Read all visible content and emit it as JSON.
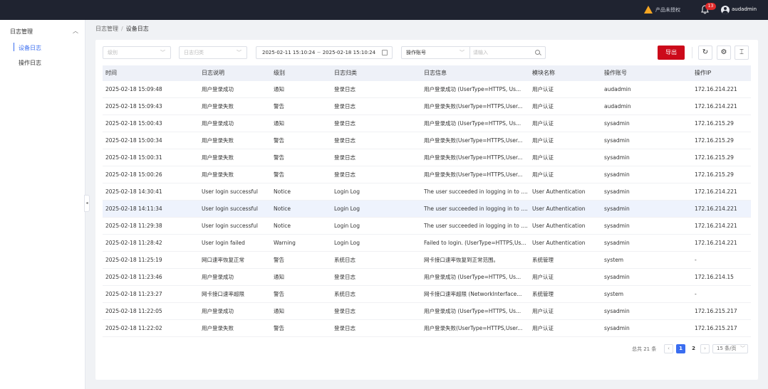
{
  "topbar": {
    "license_warning": "产品未授权",
    "notification_count": "13",
    "username": "audadmin"
  },
  "sidebar": {
    "group_label": "日志管理",
    "items": [
      {
        "label": "设备日志",
        "active": true
      },
      {
        "label": "操作日志",
        "active": false
      }
    ]
  },
  "breadcrumb": {
    "parent": "日志管理",
    "separator": "/",
    "current": "设备日志"
  },
  "filters": {
    "level_placeholder": "级别",
    "category_placeholder": "日志归类",
    "date_start": "2025-02-11 15:10:24",
    "date_separator": "~",
    "date_end": "2025-02-18 15:10:24",
    "field_select": "操作账号",
    "search_placeholder": "请输入"
  },
  "toolbar": {
    "export_label": "导出"
  },
  "table": {
    "columns": [
      "时间",
      "日志说明",
      "级别",
      "日志归类",
      "日志信息",
      "模块名称",
      "操作账号",
      "操作IP"
    ],
    "rows": [
      [
        "2025-02-18 15:09:48",
        "用户登录成功",
        "通知",
        "登录日志",
        "用户登录成功 (UserType=HTTPS, Us...",
        "用户认证",
        "audadmin",
        "172.16.214.221"
      ],
      [
        "2025-02-18 15:09:43",
        "用户登录失败",
        "警告",
        "登录日志",
        "用户登录失败(UserType=HTTPS,User...",
        "用户认证",
        "audadmin",
        "172.16.214.221"
      ],
      [
        "2025-02-18 15:00:43",
        "用户登录成功",
        "通知",
        "登录日志",
        "用户登录成功 (UserType=HTTPS, Us...",
        "用户认证",
        "sysadmin",
        "172.16.215.29"
      ],
      [
        "2025-02-18 15:00:34",
        "用户登录失败",
        "警告",
        "登录日志",
        "用户登录失败(UserType=HTTPS,User...",
        "用户认证",
        "sysadmin",
        "172.16.215.29"
      ],
      [
        "2025-02-18 15:00:31",
        "用户登录失败",
        "警告",
        "登录日志",
        "用户登录失败(UserType=HTTPS,User...",
        "用户认证",
        "sysadmin",
        "172.16.215.29"
      ],
      [
        "2025-02-18 15:00:26",
        "用户登录失败",
        "警告",
        "登录日志",
        "用户登录失败(UserType=HTTPS,User...",
        "用户认证",
        "sysadmin",
        "172.16.215.29"
      ],
      [
        "2025-02-18 14:30:41",
        "User login successful",
        "Notice",
        "Login Log",
        "The user succeeded in logging in to ....",
        "User Authentication",
        "sysadmin",
        "172.16.214.221"
      ],
      [
        "2025-02-18 14:11:34",
        "User login successful",
        "Notice",
        "Login Log",
        "The user succeeded in logging in to ....",
        "User Authentication",
        "sysadmin",
        "172.16.214.221"
      ],
      [
        "2025-02-18 11:29:38",
        "User login successful",
        "Notice",
        "Login Log",
        "The user succeeded in logging in to ....",
        "User Authentication",
        "sysadmin",
        "172.16.214.221"
      ],
      [
        "2025-02-18 11:28:42",
        "User login failed",
        "Warning",
        "Login Log",
        "Failed to login. (UserType=HTTPS,Us...",
        "User Authentication",
        "sysadmin",
        "172.16.214.221"
      ],
      [
        "2025-02-18 11:25:19",
        "网口速率恢复正常",
        "警告",
        "系统日志",
        "网卡接口速率恢复到正常范围。",
        "系统管理",
        "system",
        "-"
      ],
      [
        "2025-02-18 11:23:46",
        "用户登录成功",
        "通知",
        "登录日志",
        "用户登录成功 (UserType=HTTPS, Us...",
        "用户认证",
        "sysadmin",
        "172.16.214.15"
      ],
      [
        "2025-02-18 11:23:27",
        "网卡接口速率超限",
        "警告",
        "系统日志",
        "网卡接口速率超限 (NetworkInterface...",
        "系统管理",
        "system",
        "-"
      ],
      [
        "2025-02-18 11:22:05",
        "用户登录成功",
        "通知",
        "登录日志",
        "用户登录成功 (UserType=HTTPS, Us...",
        "用户认证",
        "sysadmin",
        "172.16.215.217"
      ],
      [
        "2025-02-18 11:22:02",
        "用户登录失败",
        "警告",
        "登录日志",
        "用户登录失败(UserType=HTTPS,User...",
        "用户认证",
        "sysadmin",
        "172.16.215.217"
      ]
    ],
    "highlighted_row": 7
  },
  "pagination": {
    "total_text": "总共 21 条",
    "pages": [
      "1",
      "2"
    ],
    "current_page": "1",
    "page_size": "15 条/页"
  },
  "colors": {
    "accent": "#3a6df0",
    "export": "#cc0a1a",
    "topbar": "#1f2330",
    "warning": "#f5a623"
  }
}
